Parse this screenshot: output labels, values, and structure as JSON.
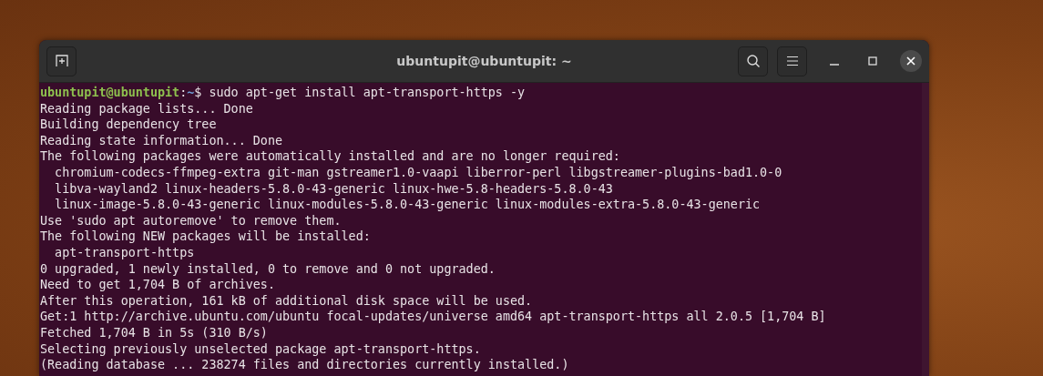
{
  "window": {
    "title": "ubuntupit@ubuntupit: ~"
  },
  "prompt": [
    {
      "kind": "user",
      "text": "ubuntupit@ubuntupit"
    },
    {
      "kind": "sep",
      "text": ":"
    },
    {
      "kind": "path",
      "text": "~"
    },
    {
      "kind": "command",
      "text": "$ sudo apt-get install apt-transport-https -y"
    }
  ],
  "output": [
    "Reading package lists... Done",
    "Building dependency tree",
    "Reading state information... Done",
    "The following packages were automatically installed and are no longer required:",
    "  chromium-codecs-ffmpeg-extra git-man gstreamer1.0-vaapi liberror-perl libgstreamer-plugins-bad1.0-0",
    "  libva-wayland2 linux-headers-5.8.0-43-generic linux-hwe-5.8-headers-5.8.0-43",
    "  linux-image-5.8.0-43-generic linux-modules-5.8.0-43-generic linux-modules-extra-5.8.0-43-generic",
    "Use 'sudo apt autoremove' to remove them.",
    "The following NEW packages will be installed:",
    "  apt-transport-https",
    "0 upgraded, 1 newly installed, 0 to remove and 0 not upgraded.",
    "Need to get 1,704 B of archives.",
    "After this operation, 161 kB of additional disk space will be used.",
    "Get:1 http://archive.ubuntu.com/ubuntu focal-updates/universe amd64 apt-transport-https all 2.0.5 [1,704 B]",
    "Fetched 1,704 B in 5s (310 B/s)",
    "Selecting previously unselected package apt-transport-https.",
    "(Reading database ... 238274 files and directories currently installed.)"
  ]
}
